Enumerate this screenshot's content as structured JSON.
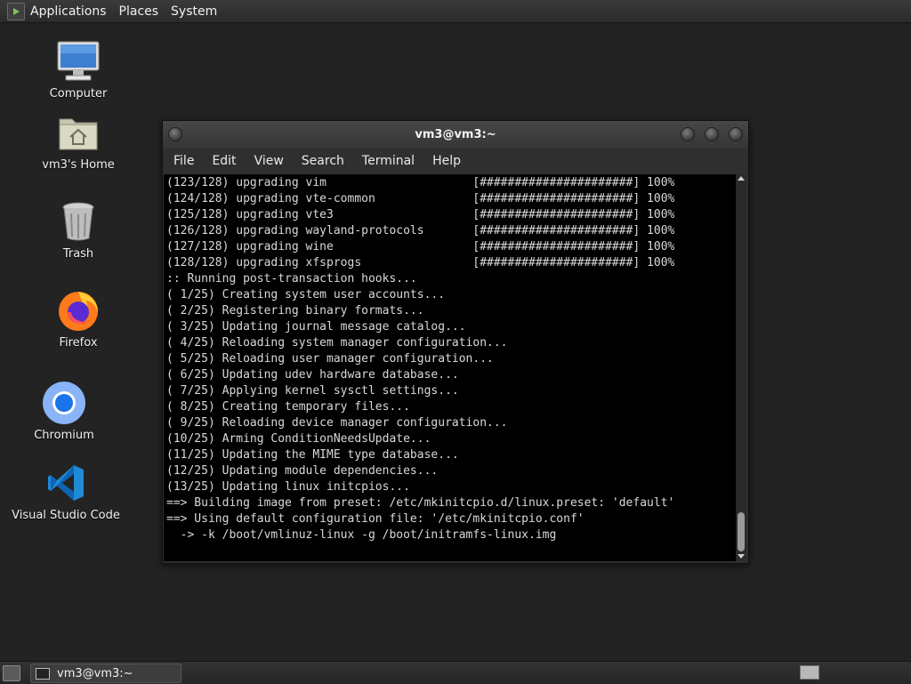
{
  "top_panel": {
    "menus": [
      "Applications",
      "Places",
      "System"
    ]
  },
  "desktop": {
    "icons": [
      {
        "label": "Computer",
        "icon": "computer-icon"
      },
      {
        "label": "vm3's Home",
        "icon": "home-folder-icon"
      },
      {
        "label": "Trash",
        "icon": "trash-icon"
      },
      {
        "label": "Firefox",
        "icon": "firefox-icon"
      },
      {
        "label": "Chromium",
        "icon": "chromium-icon"
      },
      {
        "label": "Visual Studio Code",
        "icon": "vscode-icon"
      }
    ]
  },
  "terminal": {
    "title": "vm3@vm3:~",
    "menu": [
      "File",
      "Edit",
      "View",
      "Search",
      "Terminal",
      "Help"
    ],
    "lines": [
      "(123/128) upgrading vim                     [######################] 100%",
      "(124/128) upgrading vte-common              [######################] 100%",
      "(125/128) upgrading vte3                    [######################] 100%",
      "(126/128) upgrading wayland-protocols       [######################] 100%",
      "(127/128) upgrading wine                    [######################] 100%",
      "(128/128) upgrading xfsprogs                [######################] 100%",
      ":: Running post-transaction hooks...",
      "( 1/25) Creating system user accounts...",
      "( 2/25) Registering binary formats...",
      "( 3/25) Updating journal message catalog...",
      "( 4/25) Reloading system manager configuration...",
      "( 5/25) Reloading user manager configuration...",
      "( 6/25) Updating udev hardware database...",
      "( 7/25) Applying kernel sysctl settings...",
      "( 8/25) Creating temporary files...",
      "( 9/25) Reloading device manager configuration...",
      "(10/25) Arming ConditionNeedsUpdate...",
      "(11/25) Updating the MIME type database...",
      "(12/25) Updating module dependencies...",
      "(13/25) Updating linux initcpios...",
      "==> Building image from preset: /etc/mkinitcpio.d/linux.preset: 'default'",
      "==> Using default configuration file: '/etc/mkinitcpio.conf'",
      "  -> -k /boot/vmlinuz-linux -g /boot/initramfs-linux.img"
    ]
  },
  "taskbar": {
    "task_label": "vm3@vm3:~"
  },
  "colors": {
    "desktop_bg": "#232323",
    "terminal_bg": "#000000",
    "terminal_fg": "#d9d9d9"
  }
}
